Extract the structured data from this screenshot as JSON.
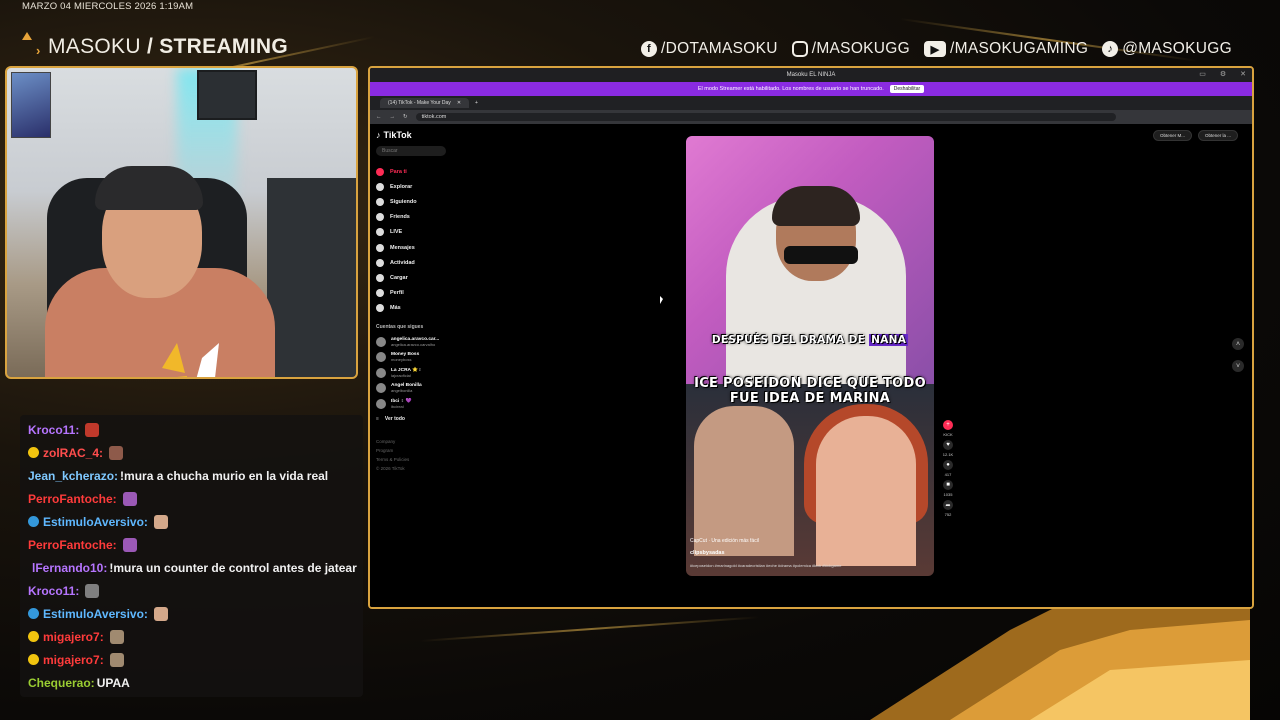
{
  "overlay": {
    "datetime": "MARZO 04 MIERCOLES 2026 1:19AM",
    "brand_name": "MASOKU",
    "brand_slash": "/",
    "brand_section": "STREAMING",
    "socials": [
      {
        "icon": "facebook-icon",
        "glyph": "f",
        "label": "/DOTAMASOKU"
      },
      {
        "icon": "instagram-icon",
        "glyph": "",
        "label": "/MASOKUGG"
      },
      {
        "icon": "youtube-icon",
        "glyph": "▶",
        "label": "/MASOKUGAMING"
      },
      {
        "icon": "tiktok-icon",
        "glyph": "♪",
        "label": "@MASOKUGG"
      }
    ],
    "accent": "#d9a33f"
  },
  "chat": [
    {
      "user": "Kroco11:",
      "color": "#b675ff",
      "badge": "",
      "text": "",
      "emote": "#c0392b"
    },
    {
      "user": "zolRAC_4:",
      "color": "#ff4d4d",
      "badge": "#f1c40f",
      "text": "",
      "emote": "#8e5a4a"
    },
    {
      "user": "Jean_kcherazo:",
      "color": "#7fc9ff",
      "badge": "",
      "text": "!mura a chucha murio en la vida real",
      "emote": ""
    },
    {
      "user": "PerroFantoche:",
      "color": "#ff3b3b",
      "badge": "",
      "text": "",
      "emote": "#9b59b6"
    },
    {
      "user": "EstimuloAversivo:",
      "color": "#5fb8ff",
      "badge": "#3498db",
      "text": "",
      "emote": "#d4a88a"
    },
    {
      "user": "PerroFantoche:",
      "color": "#ff3b3b",
      "badge": "",
      "text": "",
      "emote": "#9b59b6"
    },
    {
      "user": "lFernando10:",
      "color": "#b675ff",
      "badge": "#e74c3c",
      "text": "!mura un counter de control antes de jatear",
      "emote": ""
    },
    {
      "user": "Kroco11:",
      "color": "#b675ff",
      "badge": "",
      "text": "",
      "emote": "#7f7f7f"
    },
    {
      "user": "EstimuloAversivo:",
      "color": "#5fb8ff",
      "badge": "#3498db",
      "text": "",
      "emote": "#d4a88a"
    },
    {
      "user": "migajero7:",
      "color": "#ff3b3b",
      "badge": "#f1c40f",
      "text": "",
      "emote": "#a08a70"
    },
    {
      "user": "migajero7:",
      "color": "#ff3b3b",
      "badge": "#f1c40f",
      "text": "",
      "emote": "#a08a70"
    },
    {
      "user": "Chequerao:",
      "color": "#9acd32",
      "badge": "",
      "text": "UPAA",
      "emote": ""
    }
  ],
  "window": {
    "title": "Masoku EL NINJA",
    "streamer_notice": "El modo Streamer está habilitado. Los nombres de usuario se han truncado.",
    "streamer_button": "Deshabilitar",
    "tab_title": "(14) TikTok - Make Your Day",
    "url": "tiktok.com"
  },
  "tiktok": {
    "logo": "TikTok",
    "search_placeholder": "Buscar",
    "nav": [
      {
        "label": "Para ti",
        "icon": "home-icon",
        "active": true
      },
      {
        "label": "Explorar",
        "icon": "compass-icon",
        "active": false
      },
      {
        "label": "Siguiendo",
        "icon": "following-icon",
        "active": false
      },
      {
        "label": "Friends",
        "icon": "friends-icon",
        "active": false
      },
      {
        "label": "LIVE",
        "icon": "live-icon",
        "active": false
      },
      {
        "label": "Mensajes",
        "icon": "messages-icon",
        "active": false
      },
      {
        "label": "Actividad",
        "icon": "activity-icon",
        "active": false
      },
      {
        "label": "Cargar",
        "icon": "upload-icon",
        "active": false
      },
      {
        "label": "Perfil",
        "icon": "profile-icon",
        "active": false
      },
      {
        "label": "Más",
        "icon": "more-icon",
        "active": false
      }
    ],
    "following_title": "Cuentas que sigues",
    "accounts": [
      {
        "name": "angelica.aravco.car...",
        "handle": "angelica.aravco.carvalho"
      },
      {
        "name": "Money Boss",
        "handle": "moneyboss"
      },
      {
        "name": "La JCRA ⭐♀",
        "handle": "lajcraoficial"
      },
      {
        "name": "Angel Bonilla",
        "handle": "angelbonilla"
      },
      {
        "name": "Ibci ♀ 💜",
        "handle": "ibcireal"
      }
    ],
    "see_all": "Ver todo",
    "footer": [
      "Company",
      "Program",
      "Terms & Policies",
      "© 2026 TikTok"
    ],
    "get_app": [
      "Obtener M...",
      "Obtener la ..."
    ],
    "video": {
      "caption_top": "DESPUÉS DEL DRAMA DE",
      "caption_highlight": "NANA",
      "caption_main_line1": "ICE POSEIDON DICE QUE TODO",
      "caption_main_line2": "FUE IDEA DE MARINA",
      "meta": "CapCut · Una edición más fácil",
      "user": "clipsbysadas",
      "tags": "#iceposeidon #marinagold #caradecristian #eche #drama #polemica #kick #kickgame"
    },
    "actions": [
      {
        "icon": "kick-icon",
        "glyph": "+",
        "count": "KICK"
      },
      {
        "icon": "heart-icon",
        "glyph": "♥",
        "count": "12.1K"
      },
      {
        "icon": "comment-icon",
        "glyph": "●",
        "count": "417"
      },
      {
        "icon": "bookmark-icon",
        "glyph": "■",
        "count": "1035"
      },
      {
        "icon": "share-icon",
        "glyph": "➦",
        "count": "752"
      }
    ]
  }
}
